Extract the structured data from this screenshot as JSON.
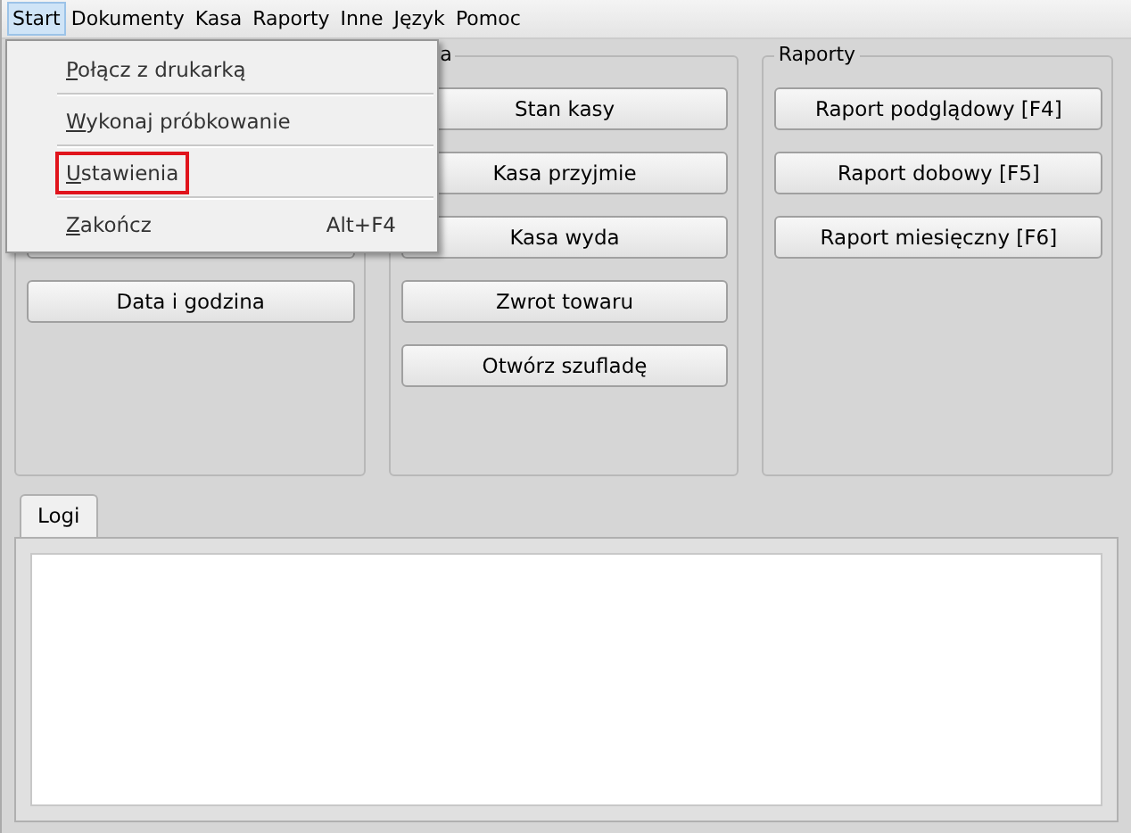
{
  "menubar": [
    {
      "label": "Start",
      "selected": true
    },
    {
      "label": "Dokumenty",
      "selected": false
    },
    {
      "label": "Kasa",
      "selected": false
    },
    {
      "label": "Raporty",
      "selected": false
    },
    {
      "label": "Inne",
      "selected": false
    },
    {
      "label": "Język",
      "selected": false
    },
    {
      "label": "Pomoc",
      "selected": false
    }
  ],
  "menu": {
    "items": [
      {
        "label": "Połącz z drukarką",
        "highlighted": false
      },
      {
        "label": "Wykonaj próbkowanie",
        "highlighted": false
      },
      {
        "label": "Ustawienia",
        "highlighted": true
      },
      {
        "label": "Zakończ",
        "shortcut": "Alt+F4",
        "highlighted": false
      }
    ]
  },
  "groups": [
    {
      "buttons": [
        "Data i godzina"
      ]
    },
    {
      "title": "a",
      "buttons": [
        "Stan kasy",
        "Kasa przyjmie",
        "Kasa wyda",
        "Zwrot towaru",
        "Otwórz szufladę"
      ]
    },
    {
      "title": "Raporty",
      "buttons": [
        "Raport podglądowy [F4]",
        "Raport dobowy [F5]",
        "Raport miesięczny [F6]"
      ]
    }
  ],
  "log_tab": {
    "label": "Logi"
  }
}
